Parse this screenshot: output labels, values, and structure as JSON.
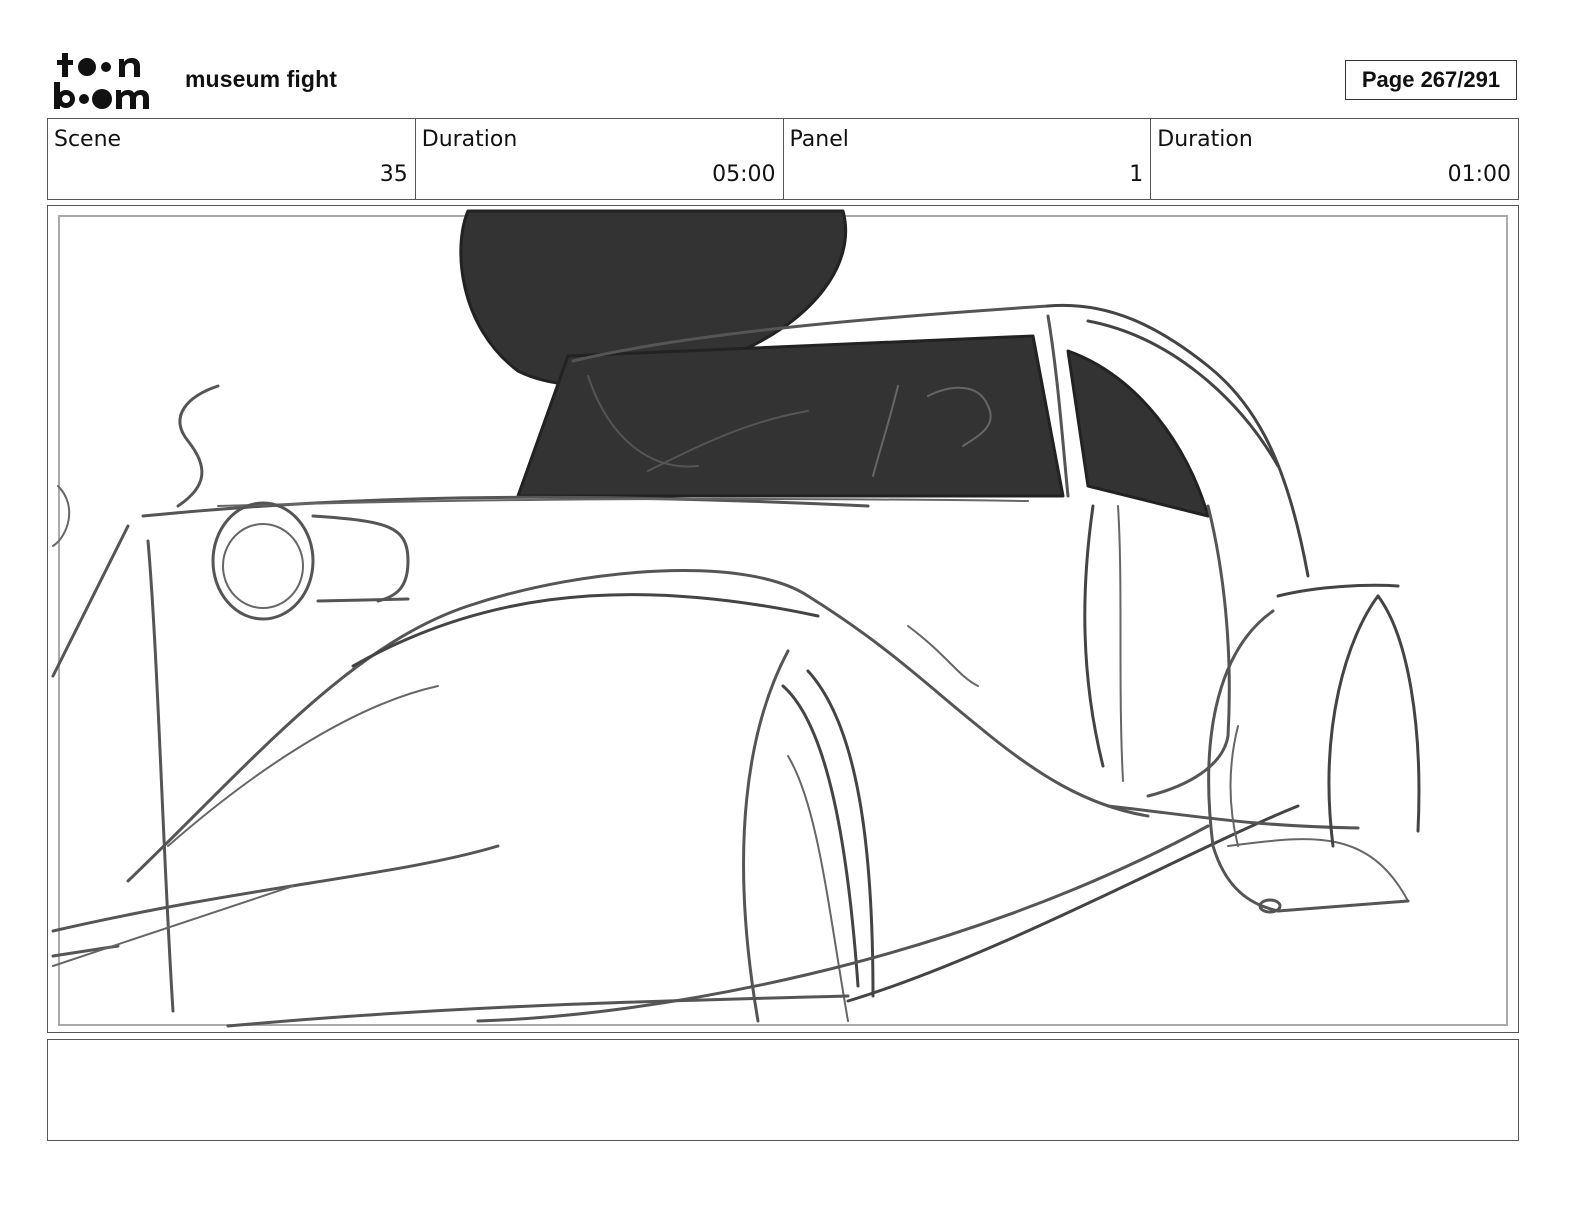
{
  "header": {
    "logo_text": "toon boom",
    "project_title": "museum fight",
    "page_label": "Page 267/291"
  },
  "info": {
    "scene_label": "Scene",
    "scene_value": "35",
    "scene_duration_label": "Duration",
    "scene_duration_value": "05:00",
    "panel_label": "Panel",
    "panel_value": "1",
    "panel_duration_label": "Duration",
    "panel_duration_value": "01:00"
  },
  "panel": {
    "image_subject": "rough pencil sketch of a vintage car with dark silhouettes in the window",
    "stroke_color": "#444444",
    "fill_color": "#333333"
  },
  "notes": {
    "text": ""
  }
}
